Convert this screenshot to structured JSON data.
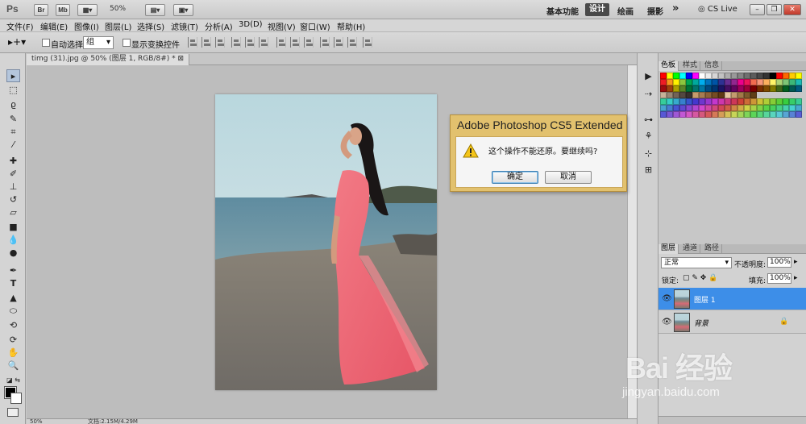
{
  "app": {
    "logo": "Ps",
    "bridge_button": "Br",
    "minibridge_button": "Mb",
    "zoom": "50%",
    "workspaces": [
      "基本功能",
      "设计",
      "绘画",
      "摄影"
    ],
    "active_workspace": "设计",
    "overflow": "»",
    "cslive": "CS Live"
  },
  "menu": [
    "文件(F)",
    "编辑(E)",
    "图像(I)",
    "图层(L)",
    "选择(S)",
    "滤镜(T)",
    "分析(A)",
    "3D(D)",
    "视图(V)",
    "窗口(W)",
    "帮助(H)"
  ],
  "options": {
    "auto_select_label": "自动选择:",
    "auto_select_value": "组",
    "show_transform_label": "显示变换控件"
  },
  "document": {
    "tab_title": "timg (31).jpg @ 50% (图层 1, RGB/8#) *",
    "status_zoom": "50%",
    "status_doc": "文档:2.15M/4.29M"
  },
  "dialog": {
    "title": "Adobe Photoshop CS5 Extended",
    "message": "这个操作不能还原。要继续吗?",
    "ok": "确定",
    "cancel": "取消"
  },
  "swatches_panel": {
    "tabs": [
      "色板",
      "样式",
      "信息"
    ],
    "active_tab": "色板"
  },
  "layers_panel": {
    "tabs": [
      "图层",
      "通道",
      "路径"
    ],
    "active_tab": "图层",
    "blend_mode": "正常",
    "opacity_label": "不透明度:",
    "opacity": "100%",
    "lock_label": "锁定:",
    "fill_label": "填充:",
    "fill": "100%",
    "layers": [
      {
        "name": "图层 1",
        "selected": true
      },
      {
        "name": "背景",
        "selected": false
      }
    ]
  },
  "watermark": {
    "brand": "Bai 经验",
    "url": "jingyan.baidu.com"
  },
  "colors": {
    "selection_blue": "#3d8ee8",
    "dialog_gold": "#e2c16e"
  }
}
